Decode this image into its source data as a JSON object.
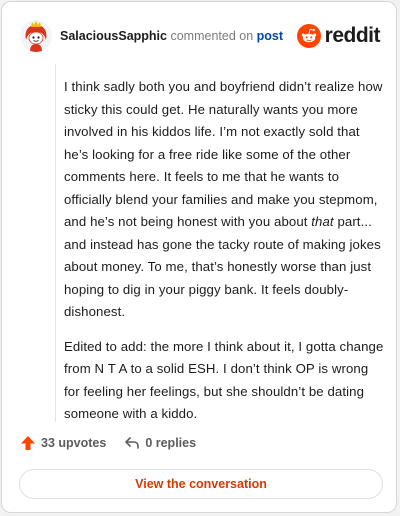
{
  "header": {
    "username": "SalaciousSapphic",
    "action_text": "commented on",
    "post_link": "post",
    "logo_text": "reddit"
  },
  "comment": {
    "p1_a": "I think sadly both you and boyfriend didn’t realize how sticky this could get. He naturally wants you more involved in his kiddos life. I’m not exactly sold that he’s looking for a free ride like some of the other comments here. It feels to me that he wants to officially blend your families and make you stepmom, and he’s not being honest with you about ",
    "p1_em": "that",
    "p1_b": " part... and instead has gone the tacky route of making jokes about money. To me, that’s honestly worse than just hoping to dig in your piggy bank. It feels doubly-dishonest.",
    "p2": "Edited to add: the more I think about it, I gotta change from N T A to a solid ESH. I don’t think OP is wrong for feeling her feelings, but she shouldn’t be dating someone with a kiddo."
  },
  "footer": {
    "upvotes": "33 upvotes",
    "replies": "0 replies"
  },
  "button": {
    "view_label": "View the conversation"
  },
  "colors": {
    "brand": "#ff4500",
    "link": "#0045ac",
    "button_text": "#d93a00"
  },
  "icons": {
    "avatar": "snoo-avatar-icon",
    "logo": "reddit-logo-icon",
    "upvote": "upvote-arrow-icon",
    "reply": "reply-arrow-icon"
  }
}
